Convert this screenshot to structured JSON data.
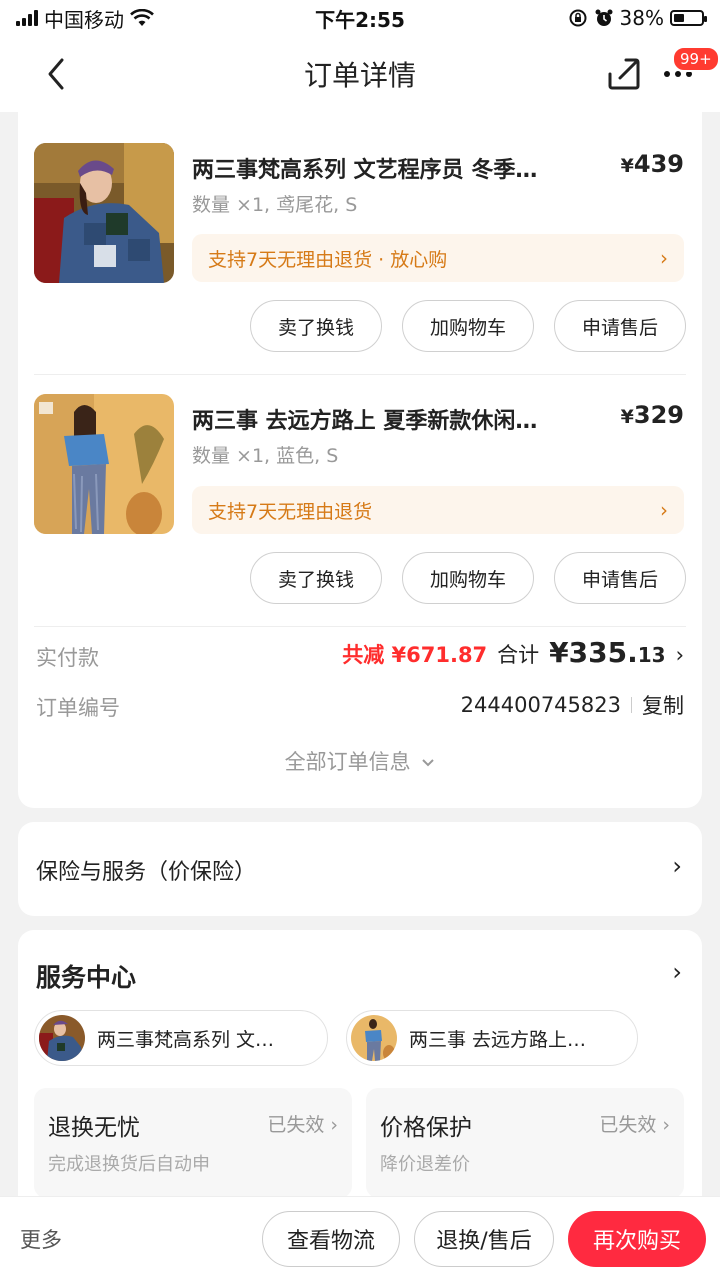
{
  "status_bar": {
    "carrier": "中国移动",
    "time": "下午2:55",
    "battery": "38%"
  },
  "nav": {
    "title": "订单详情",
    "badge": "99+"
  },
  "products": [
    {
      "title": "两三事梵高系列 文艺程序员 冬季…",
      "price_symbol": "¥",
      "price": "439",
      "spec": "数量 ×1, 鸢尾花, S",
      "promo": "支持7天无理由退货 · 放心购",
      "buttons": [
        "卖了换钱",
        "加购物车",
        "申请售后"
      ]
    },
    {
      "title": "两三事 去远方路上 夏季新款休闲…",
      "price_symbol": "¥",
      "price": "329",
      "spec": "数量 ×1, 蓝色, S",
      "promo": "支持7天无理由退货",
      "buttons": [
        "卖了换钱",
        "加购物车",
        "申请售后"
      ]
    }
  ],
  "payment": {
    "label": "实付款",
    "discount": "共减 ¥671.87",
    "total_label": "合计",
    "total_symbol": "¥",
    "total_int": "335.",
    "total_dec": "13"
  },
  "order": {
    "label": "订单编号",
    "number": "244400745823",
    "copy": "复制"
  },
  "all_info": "全部订单信息",
  "insurance": {
    "label": "保险与服务（价保险）"
  },
  "service_center": {
    "title": "服务中心",
    "chips": [
      "两三事梵高系列 文…",
      "两三事 去远方路上…"
    ],
    "boxes": [
      {
        "name": "退换无忧",
        "status": "已失效",
        "desc": "完成退换货后自动申"
      },
      {
        "name": "价格保护",
        "status": "已失效",
        "desc": "降价退差价"
      }
    ]
  },
  "bottom_bar": {
    "more": "更多",
    "logistics": "查看物流",
    "return": "退换/售后",
    "rebuy": "再次购买"
  },
  "colors": {
    "accent_red": "#ff2a40",
    "discount_red": "#ff2d2d",
    "promo_orange": "#d67a17",
    "promo_bg": "#fdf5ec"
  }
}
